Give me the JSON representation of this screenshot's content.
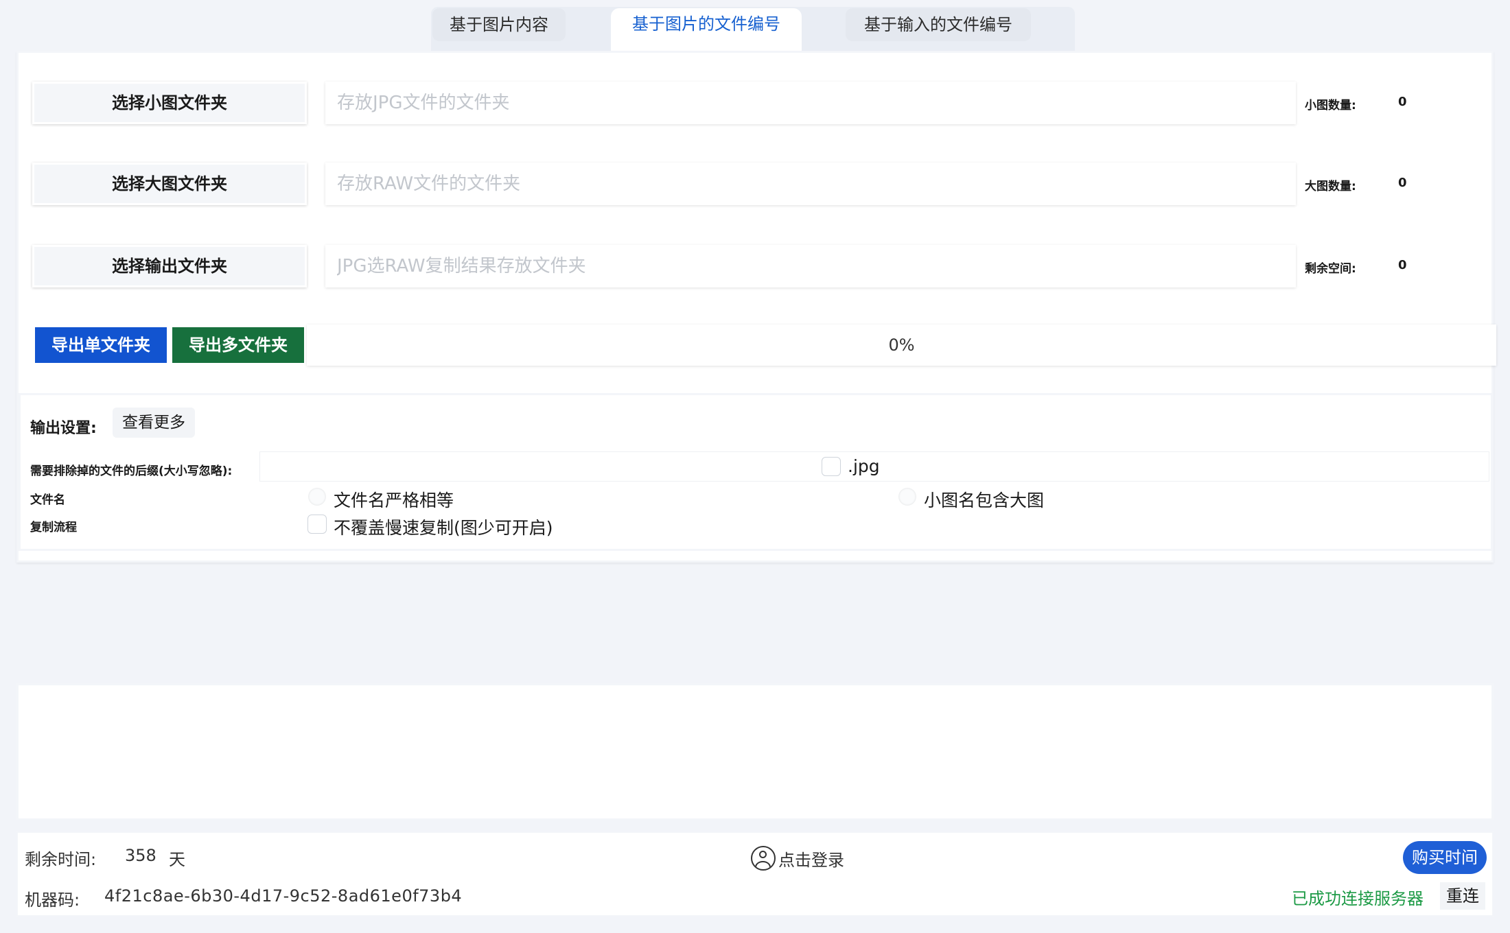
{
  "tabs": [
    {
      "label": "基于图片内容",
      "active": false
    },
    {
      "label": "基于图片的文件编号",
      "active": true
    },
    {
      "label": "基于输入的文件编号",
      "active": false
    }
  ],
  "folders": {
    "small": {
      "button": "选择小图文件夹",
      "placeholder": "存放JPG文件的文件夹",
      "value": "",
      "stat_label": "小图数量:",
      "stat_value": "0"
    },
    "large": {
      "button": "选择大图文件夹",
      "placeholder": "存放RAW文件的文件夹",
      "value": "",
      "stat_label": "大图数量:",
      "stat_value": "0"
    },
    "output": {
      "button": "选择输出文件夹",
      "placeholder": "JPG选RAW复制结果存放文件夹",
      "value": "",
      "stat_label": "剩余空间:",
      "stat_value": "0"
    }
  },
  "export": {
    "single_label": "导出单文件夹",
    "multi_label": "导出多文件夹",
    "single_color": "#1254d0",
    "multi_color": "#17703d",
    "progress_text": "0%",
    "progress_fraction": 0
  },
  "settings": {
    "title": "输出设置:",
    "more_label": "查看更多",
    "exclude_label": "需要排除掉的文件的后缀(大小写忽略):",
    "exclude_options": [
      {
        "label": ".jpg",
        "checked": false
      }
    ],
    "filename_label": "文件名",
    "filename_options": [
      {
        "label": "文件名严格相等",
        "selected": false
      },
      {
        "label": "小图名包含大图",
        "selected": false
      }
    ],
    "copy_label": "复制流程",
    "copy_options": [
      {
        "label": "不覆盖慢速复制(图少可开启)",
        "checked": false
      }
    ]
  },
  "footer": {
    "remaining_label": "剩余时间:",
    "remaining_value": "358",
    "remaining_unit": "天",
    "login_label": "点击登录",
    "buy_label": "购买时间",
    "machine_label": "机器码:",
    "machine_code": "4f21c8ae-6b30-4d17-9c52-8ad61e0f73b4",
    "status_text": "已成功连接服务器",
    "status_color": "#1c9a45",
    "reconnect_label": "重连"
  }
}
